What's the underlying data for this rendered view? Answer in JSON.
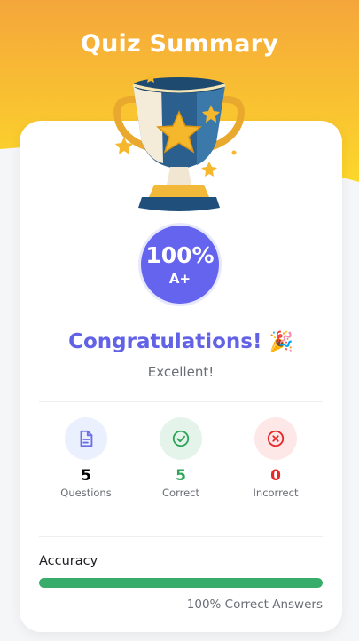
{
  "page_title": "Quiz Summary",
  "score": {
    "percent": "100%",
    "grade": "A+"
  },
  "result": {
    "heading": "Congratulations!",
    "emoji": "🎉",
    "message": "Excellent!"
  },
  "stats": [
    {
      "value": "5",
      "label": "Questions",
      "icon": "document-icon",
      "color": "#000000",
      "bg": "#eaf0fd",
      "icon_color": "#6b6ee8"
    },
    {
      "value": "5",
      "label": "Correct",
      "icon": "check-circle-icon",
      "color": "#2fa45a",
      "bg": "#e5f4ea",
      "icon_color": "#2fa45a"
    },
    {
      "value": "0",
      "label": "Incorrect",
      "icon": "x-circle-icon",
      "color": "#e8292b",
      "bg": "#fde7e7",
      "icon_color": "#e8292b"
    }
  ],
  "accuracy": {
    "label": "Accuracy",
    "fraction": 1.0,
    "caption": "100% Correct Answers"
  },
  "colors": {
    "header_top": "#f5a63b",
    "header_bottom": "#fbd22a",
    "accent": "#6464ee",
    "success": "#38ad6b"
  }
}
